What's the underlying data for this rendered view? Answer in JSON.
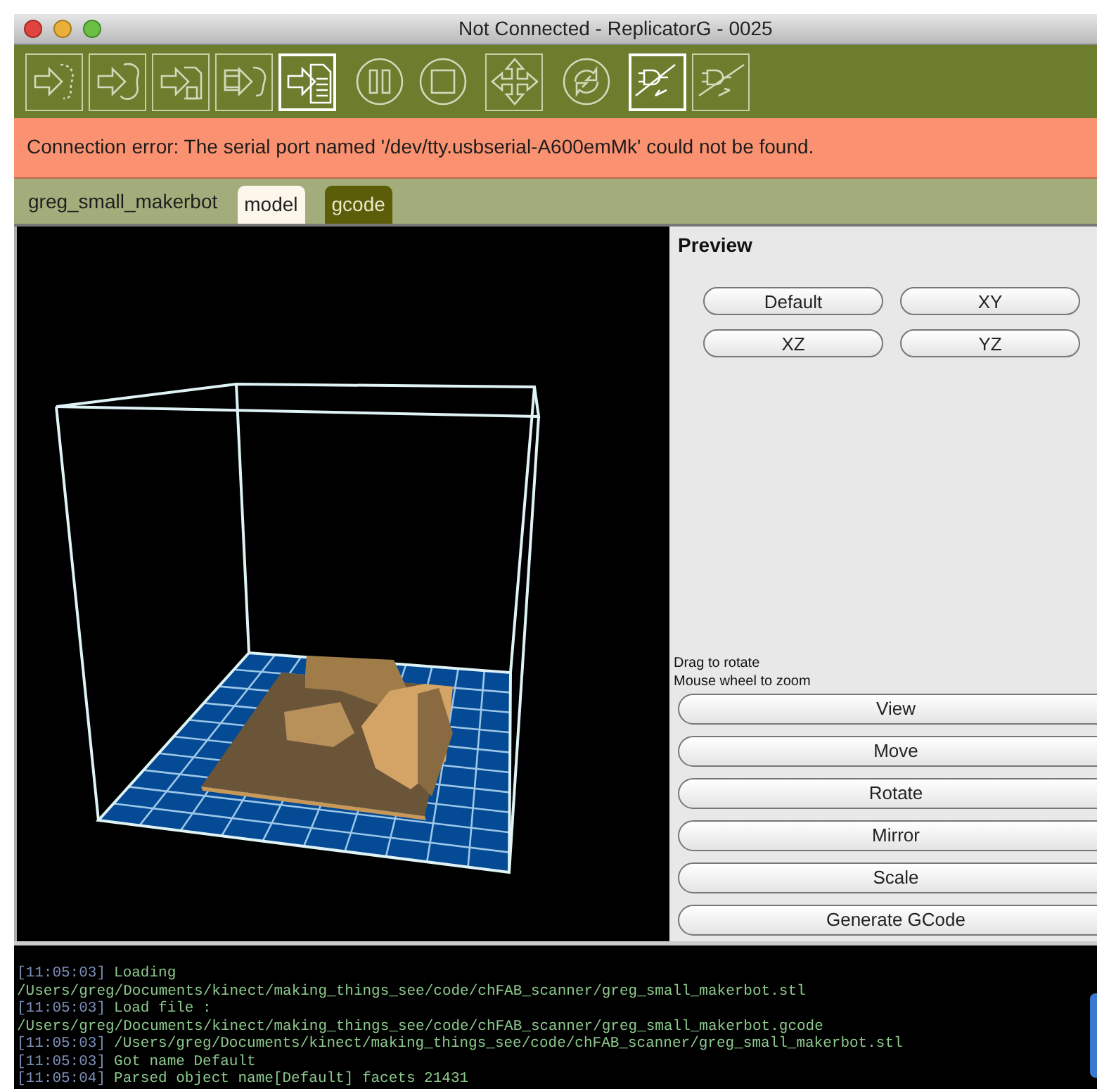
{
  "window": {
    "title": "Not Connected - ReplicatorG - 0025"
  },
  "toolbar": [
    {
      "kind": "dotted",
      "active": false
    },
    {
      "kind": "blob",
      "active": false
    },
    {
      "kind": "save",
      "active": false
    },
    {
      "kind": "remote",
      "active": false
    },
    {
      "kind": "file",
      "active": true
    },
    {
      "kind": "pause",
      "active": false
    },
    {
      "kind": "stop",
      "active": false
    },
    {
      "kind": "jog",
      "active": false
    },
    {
      "kind": "reset",
      "active": false
    },
    {
      "kind": "connect",
      "active": true
    },
    {
      "kind": "disconnect",
      "active": false
    }
  ],
  "error_message": "Connection error: The serial port named '/dev/tty.usbserial-A600emMk' could not be found.",
  "file_name": "greg_small_makerbot",
  "tabs": [
    {
      "label": "model",
      "selected": true
    },
    {
      "label": "gcode",
      "selected": false
    }
  ],
  "preview": {
    "title": "Preview",
    "view_buttons": [
      "Default",
      "XY",
      "XZ",
      "YZ"
    ]
  },
  "hints": [
    "Drag to rotate",
    "Mouse wheel to zoom"
  ],
  "actions": [
    "View",
    "Move",
    "Rotate",
    "Mirror",
    "Scale",
    "Generate GCode"
  ],
  "console": [
    {
      "time": "[11:05:03]",
      "text": "Loading"
    },
    {
      "text": "/Users/greg/Documents/kinect/making_things_see/code/chFAB_scanner/greg_small_makerbot.stl"
    },
    {
      "time": "[11:05:03]",
      "text": "Load file :"
    },
    {
      "text": "/Users/greg/Documents/kinect/making_things_see/code/chFAB_scanner/greg_small_makerbot.gcode"
    },
    {
      "time": "[11:05:03]",
      "text": "/Users/greg/Documents/kinect/making_things_see/code/chFAB_scanner/greg_small_makerbot.stl"
    },
    {
      "time": "[11:05:03]",
      "text": "Got name Default"
    },
    {
      "time": "[11:05:04]",
      "text": "Parsed object name[Default] facets 21431"
    }
  ]
}
